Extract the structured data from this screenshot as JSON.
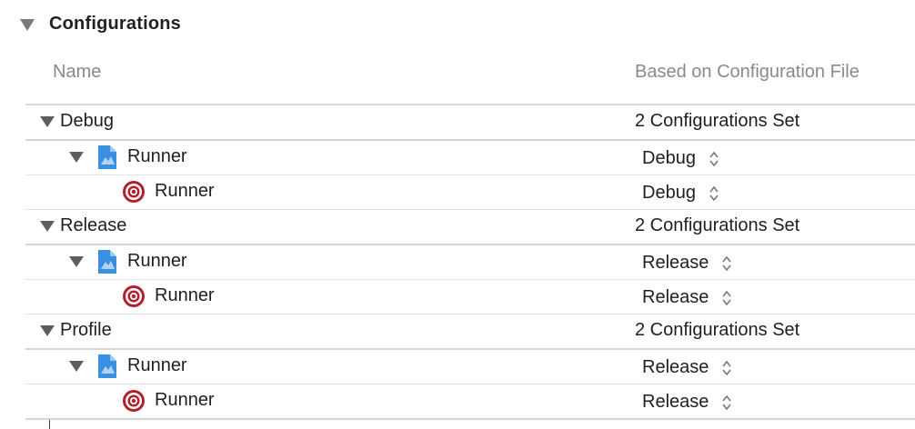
{
  "section": {
    "title": "Configurations"
  },
  "columns": {
    "name": "Name",
    "file": "Based on Configuration File"
  },
  "groups": [
    {
      "name": "Debug",
      "summary": "2 Configurations Set",
      "project": {
        "name": "Runner",
        "value": "Debug"
      },
      "target": {
        "name": "Runner",
        "value": "Debug"
      }
    },
    {
      "name": "Release",
      "summary": "2 Configurations Set",
      "project": {
        "name": "Runner",
        "value": "Release"
      },
      "target": {
        "name": "Runner",
        "value": "Release"
      }
    },
    {
      "name": "Profile",
      "summary": "2 Configurations Set",
      "project": {
        "name": "Runner",
        "value": "Release"
      },
      "target": {
        "name": "Runner",
        "value": "Release"
      }
    }
  ],
  "icons": {
    "disclosure": "disclosure-triangle-icon",
    "project": "xcode-project-icon",
    "target": "target-icon",
    "popup": "up-down-chevron-icon"
  },
  "colors": {
    "project_blue": "#3b8fe0",
    "target_red": "#b3202a"
  }
}
